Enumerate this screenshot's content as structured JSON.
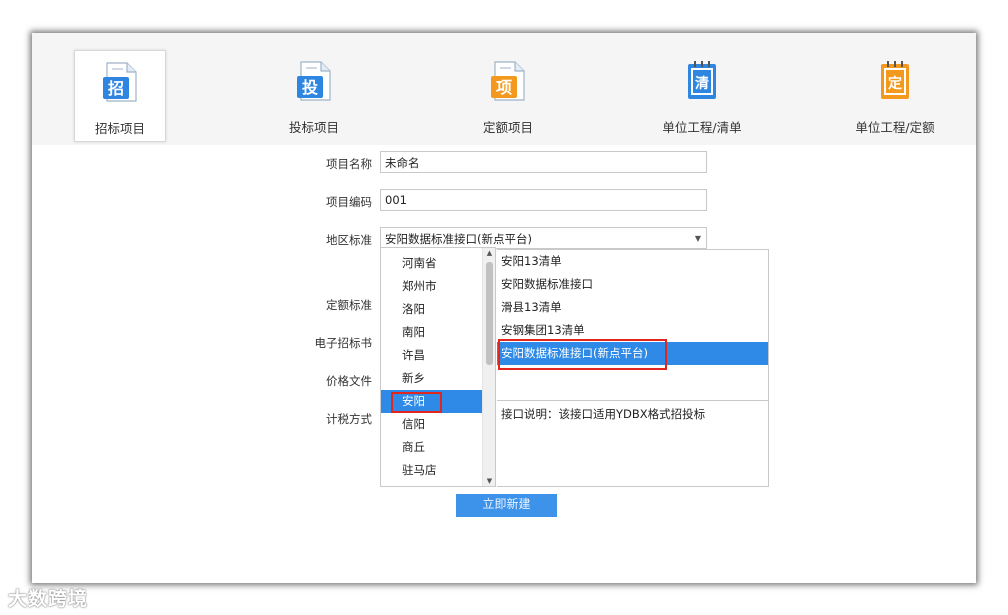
{
  "toolbar": {
    "items": [
      {
        "label": "招标项目",
        "glyph": "招",
        "color": "#2f86e0",
        "icon": "bid-invite-doc-icon"
      },
      {
        "label": "投标项目",
        "glyph": "投",
        "color": "#2f86e0",
        "icon": "bid-submit-doc-icon"
      },
      {
        "label": "定额项目",
        "glyph": "项",
        "color": "#f39a1e",
        "icon": "quota-project-doc-icon"
      },
      {
        "label": "单位工程/清单",
        "glyph": "清",
        "color": "#2f86e0",
        "icon": "bill-notebook-icon"
      },
      {
        "label": "单位工程/定额",
        "glyph": "定",
        "color": "#f39a1e",
        "icon": "quota-notebook-icon"
      }
    ]
  },
  "form": {
    "project_name_label": "项目名称",
    "project_name_value": "未命名",
    "project_code_label": "项目编码",
    "project_code_value": "001",
    "region_label": "地区标准",
    "region_value": "安阳数据标准接口(新点平台)",
    "quota_label": "定额标准",
    "ebid_label": "电子招标书",
    "price_file_label": "价格文件",
    "tax_label": "计税方式"
  },
  "dropdown": {
    "cities": [
      "河南省",
      "郑州市",
      "洛阳",
      "南阳",
      "许昌",
      "新乡",
      "安阳",
      "信阳",
      "商丘",
      "驻马店"
    ],
    "selected_city": "安阳",
    "standards": [
      "安阳13清单",
      "安阳数据标准接口",
      "滑县13清单",
      "安钢集团13清单",
      "安阳数据标准接口(新点平台)"
    ],
    "selected_standard": "安阳数据标准接口(新点平台)",
    "description": "接口说明：该接口适用YDBX格式招投标"
  },
  "create_button_label": "立即新建",
  "watermark": "大数跨境",
  "colors": {
    "accent": "#2e8ae6",
    "highlight": "#e0261f"
  }
}
